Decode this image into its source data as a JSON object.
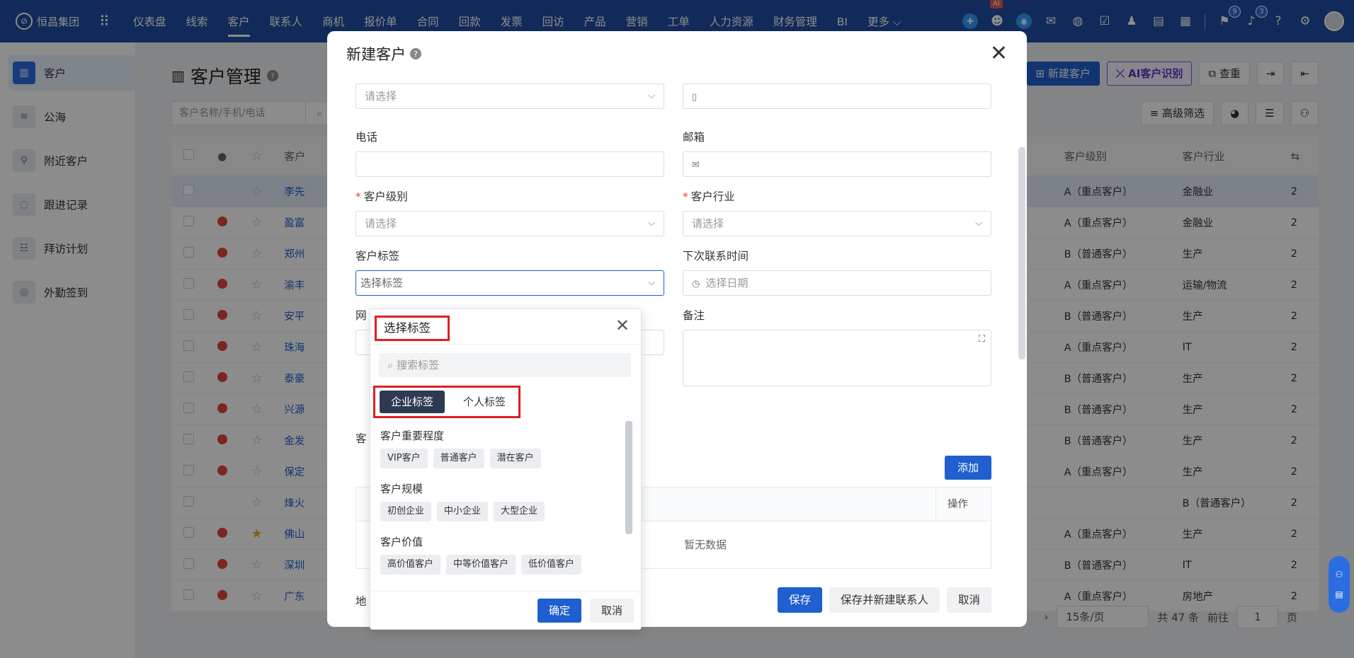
{
  "app": {
    "brand": "恒昌集团",
    "logo_icon": "logo-icon"
  },
  "nav": [
    "仪表盘",
    "线索",
    "客户",
    "联系人",
    "商机",
    "报价单",
    "合同",
    "回款",
    "发票",
    "回访",
    "产品",
    "营销",
    "工单",
    "人力资源",
    "财务管理",
    "BI",
    "更多 ⌵"
  ],
  "nav_active": "客户",
  "header_badges": {
    "ai": "AI",
    "tasks": "9",
    "notifications": "3"
  },
  "sidebar": [
    {
      "label": "客户",
      "icon": "customer-icon",
      "active": true
    },
    {
      "label": "公海",
      "icon": "sea-icon"
    },
    {
      "label": "附近客户",
      "icon": "location-icon"
    },
    {
      "label": "跟进记录",
      "icon": "chat-icon"
    },
    {
      "label": "拜访计划",
      "icon": "plan-icon"
    },
    {
      "label": "外勤签到",
      "icon": "checkin-icon"
    }
  ],
  "page": {
    "title": "客户管理",
    "search_placeholder": "客户名称/手机/电话",
    "buttons": {
      "new": "新建客户",
      "ai": "AI客户识别",
      "dedupe": "查重",
      "advanced_filter": "高级筛选"
    },
    "columns": {
      "name": "客户",
      "level": "客户级别",
      "industry": "客户行业"
    }
  },
  "table_rows": [
    {
      "name": "李先",
      "level": "A（重点客户）",
      "industry": "金融业",
      "star": false,
      "coin": false,
      "selected": true
    },
    {
      "name": "盈富",
      "level": "A（重点客户）",
      "industry": "金融业",
      "star": false,
      "coin": true
    },
    {
      "name": "郑州",
      "level": "B（普通客户）",
      "industry": "生产",
      "star": false,
      "coin": true
    },
    {
      "name": "渝丰",
      "level": "A（重点客户）",
      "industry": "运输/物流",
      "star": false,
      "coin": true
    },
    {
      "name": "安平",
      "level": "B（普通客户）",
      "industry": "生产",
      "star": false,
      "coin": true
    },
    {
      "name": "珠海",
      "level": "A（重点客户）",
      "industry": "IT",
      "star": false,
      "coin": true
    },
    {
      "name": "泰豪",
      "level": "B（普通客户）",
      "industry": "生产",
      "star": false,
      "coin": true
    },
    {
      "name": "兴源",
      "level": "B（普通客户）",
      "industry": "生产",
      "star": false,
      "coin": true
    },
    {
      "name": "金发",
      "level": "B（普通客户）",
      "industry": "生产",
      "star": false,
      "coin": true
    },
    {
      "name": "保定",
      "level": "A（重点客户）",
      "industry": "生产",
      "star": false,
      "coin": true
    },
    {
      "name": "烽火",
      "level": "",
      "industry": "B（普通客户）",
      "star": false,
      "coin": false
    },
    {
      "name": "佛山",
      "level": "A（重点客户）",
      "industry": "生产",
      "star": true,
      "coin": true
    },
    {
      "name": "深圳",
      "level": "B（普通客户）",
      "industry": "IT",
      "star": false,
      "coin": true
    },
    {
      "name": "广东",
      "level": "A（重点客户）",
      "industry": "房地产",
      "star": false,
      "coin": true
    }
  ],
  "pagination": {
    "page_size": "15条/页",
    "total": "共 47 条",
    "goto_label": "前往",
    "page": "1",
    "page_suffix": "页"
  },
  "modal": {
    "title": "新建客户",
    "fields": {
      "source_placeholder": "请选择",
      "phone_label": "电话",
      "email_label": "邮箱",
      "level_label": "客户级别",
      "level_placeholder": "请选择",
      "industry_label": "客户行业",
      "industry_placeholder": "请选择",
      "tags_label": "客户标签",
      "tags_placeholder": "选择标签",
      "next_contact_label": "下次联系时间",
      "next_contact_placeholder": "选择日期",
      "remark_label": "备注",
      "website_label": "网",
      "contact_section_label": "客",
      "address_label": "地"
    },
    "add_button": "添加",
    "op_column": "操作",
    "no_data": "暂无数据",
    "footer": {
      "save": "保存",
      "save_new_contact": "保存并新建联系人",
      "cancel": "取消"
    }
  },
  "tag_popup": {
    "title": "选择标签",
    "search_placeholder": "搜索标签",
    "tabs": [
      "企业标签",
      "个人标签"
    ],
    "groups": [
      {
        "title": "客户重要程度",
        "tags": [
          "VIP客户",
          "普通客户",
          "潜在客户"
        ]
      },
      {
        "title": "客户规模",
        "tags": [
          "初创企业",
          "中小企业",
          "大型企业"
        ]
      },
      {
        "title": "客户价值",
        "tags": [
          "高价值客户",
          "中等价值客户",
          "低价值客户"
        ]
      }
    ],
    "confirm": "确定",
    "cancel": "取消"
  }
}
